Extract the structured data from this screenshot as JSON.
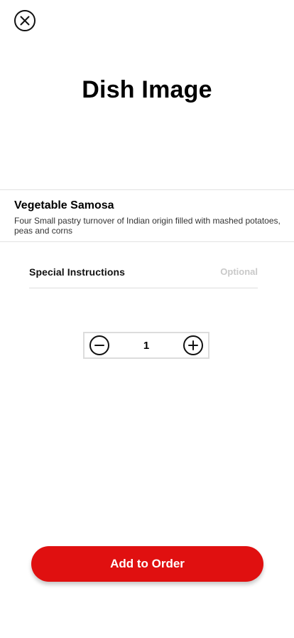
{
  "header": {
    "close_icon": "close-circle-icon"
  },
  "dish": {
    "image_placeholder": "Dish Image",
    "name": "Vegetable Samosa",
    "description": "Four Small pastry turnover of Indian origin filled with mashed potatoes, peas and corns"
  },
  "instructions": {
    "label": "Special Instructions",
    "optional": "Optional"
  },
  "quantity": {
    "value": "1",
    "decrement_icon": "minus-circle-icon",
    "increment_icon": "plus-circle-icon"
  },
  "footer": {
    "add_label": "Add to Order"
  },
  "colors": {
    "accent": "#e01010",
    "divider": "#e2e2e2",
    "muted_text": "#c9c9c9"
  }
}
